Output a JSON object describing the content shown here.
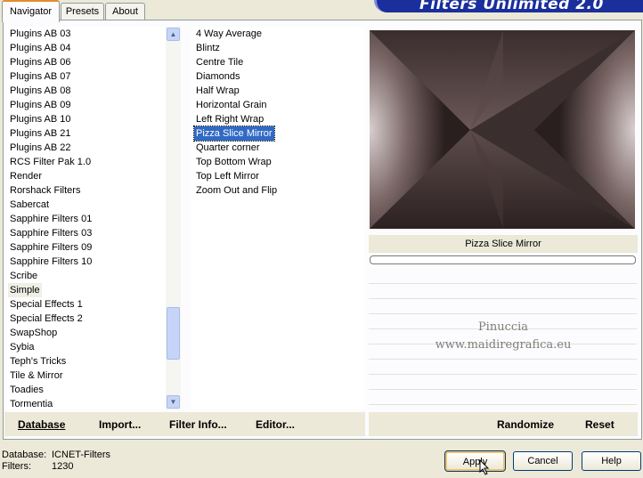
{
  "tabs": [
    {
      "label": "Navigator",
      "active": true
    },
    {
      "label": "Presets",
      "active": false
    },
    {
      "label": "About",
      "active": false
    }
  ],
  "banner_title": "Filters Unlimited 2.0",
  "categories": [
    "Plugins AB 03",
    "Plugins AB 04",
    "Plugins AB 06",
    "Plugins AB 07",
    "Plugins AB 08",
    "Plugins AB 09",
    "Plugins AB 10",
    "Plugins AB 21",
    "Plugins AB 22",
    "RCS Filter Pak 1.0",
    "Render",
    "Rorshack Filters",
    "Sabercat",
    "Sapphire Filters 01",
    "Sapphire Filters 03",
    "Sapphire Filters 09",
    "Sapphire Filters 10",
    "Scribe",
    "Simple",
    "Special Effects 1",
    "Special Effects 2",
    "SwapShop",
    "Sybia",
    "Teph's Tricks",
    "Tile & Mirror",
    "Toadies",
    "Tormentia"
  ],
  "selected_category": "Simple",
  "filters": [
    "4 Way Average",
    "Blintz",
    "Centre Tile",
    "Diamonds",
    "Half Wrap",
    "Horizontal Grain",
    "Left Right Wrap",
    "Pizza Slice Mirror",
    "Quarter corner",
    "Top Bottom Wrap",
    "Top Left Mirror",
    "Zoom Out and Flip"
  ],
  "selected_filter": "Pizza Slice Mirror",
  "preview_filter_name": "Pizza Slice Mirror",
  "watermark": {
    "line1": "Pinuccia",
    "line2": "www.maidiregrafica.eu"
  },
  "bottom_left_buttons": {
    "database": "Database",
    "import": "Import...",
    "filter_info": "Filter Info...",
    "editor": "Editor..."
  },
  "bottom_right_buttons": {
    "randomize": "Randomize",
    "reset": "Reset"
  },
  "status": {
    "database_label": "Database:",
    "database_value": "ICNET-Filters",
    "filters_label": "Filters:",
    "filters_value": "1230"
  },
  "dialog_buttons": {
    "apply": "Apply",
    "cancel": "Cancel",
    "help": "Help"
  },
  "colors": {
    "selection": "#316ac5",
    "banner": "#1a2f9c",
    "tab_accent": "#e68b2c"
  }
}
